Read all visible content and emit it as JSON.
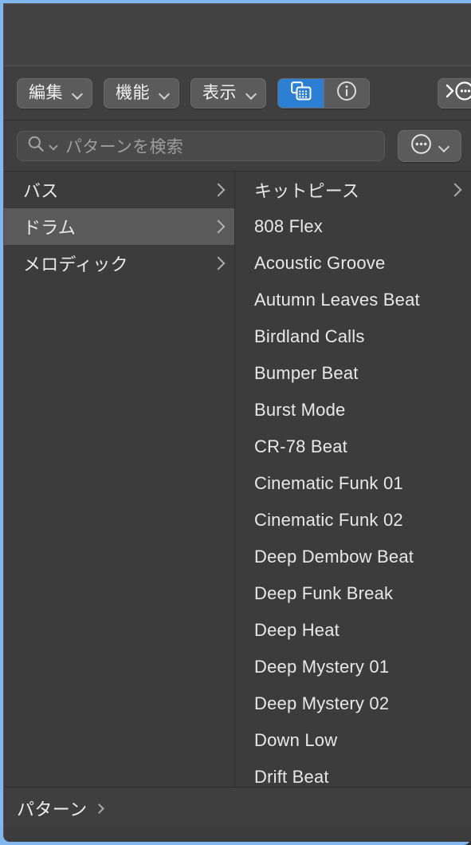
{
  "window": {
    "focus_border_color": "#82b8f0",
    "background_color": "#3c3c3c"
  },
  "toolbar": {
    "menus": [
      {
        "label": "編集",
        "icon": "chevron-down-icon"
      },
      {
        "label": "機能",
        "icon": "chevron-down-icon"
      },
      {
        "label": "表示",
        "icon": "chevron-down-icon"
      }
    ],
    "segments": [
      {
        "icon": "grid-stack-icon",
        "active": true,
        "accent_color": "#2d7fd3"
      },
      {
        "icon": "info-circle-icon",
        "active": false
      }
    ],
    "overflow": {
      "icon": "chevron-right-more-icon"
    }
  },
  "search": {
    "icon": "search-icon",
    "dropdown_icon": "chevron-down-icon",
    "placeholder": "パターンを検索",
    "value": ""
  },
  "options_button": {
    "icon": "ellipsis-circle-icon",
    "dropdown_icon": "chevron-down-icon"
  },
  "sidebar": {
    "items": [
      {
        "label": "バス",
        "has_disclosure": true,
        "selected": false
      },
      {
        "label": "ドラム",
        "has_disclosure": true,
        "selected": true
      },
      {
        "label": "メロディック",
        "has_disclosure": true,
        "selected": false
      }
    ]
  },
  "list": {
    "items": [
      {
        "label": "キットピース",
        "has_disclosure": true,
        "selected": false
      },
      {
        "label": "808 Flex",
        "has_disclosure": false,
        "selected": false
      },
      {
        "label": "Acoustic Groove",
        "has_disclosure": false,
        "selected": false
      },
      {
        "label": "Autumn Leaves Beat",
        "has_disclosure": false,
        "selected": false
      },
      {
        "label": "Birdland Calls",
        "has_disclosure": false,
        "selected": false
      },
      {
        "label": "Bumper Beat",
        "has_disclosure": false,
        "selected": false
      },
      {
        "label": "Burst Mode",
        "has_disclosure": false,
        "selected": false
      },
      {
        "label": "CR-78 Beat",
        "has_disclosure": false,
        "selected": false
      },
      {
        "label": "Cinematic Funk 01",
        "has_disclosure": false,
        "selected": false
      },
      {
        "label": "Cinematic Funk 02",
        "has_disclosure": false,
        "selected": false
      },
      {
        "label": "Deep Dembow Beat",
        "has_disclosure": false,
        "selected": false
      },
      {
        "label": "Deep Funk Break",
        "has_disclosure": false,
        "selected": false
      },
      {
        "label": "Deep Heat",
        "has_disclosure": false,
        "selected": false
      },
      {
        "label": "Deep Mystery 01",
        "has_disclosure": false,
        "selected": false
      },
      {
        "label": "Deep Mystery 02",
        "has_disclosure": false,
        "selected": false
      },
      {
        "label": "Down Low",
        "has_disclosure": false,
        "selected": false
      },
      {
        "label": "Drift Beat",
        "has_disclosure": false,
        "selected": false
      }
    ]
  },
  "statusbar": {
    "breadcrumb": "パターン",
    "breadcrumb_arrow_icon": "chevron-right-icon"
  }
}
